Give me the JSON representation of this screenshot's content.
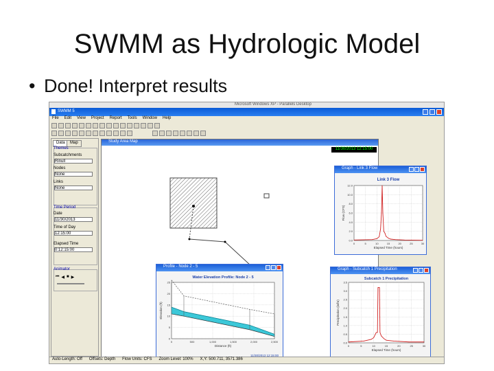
{
  "slide": {
    "title": "SWMM as Hydrologic Model",
    "bullet": "Done!  Interpret results"
  },
  "screenshot": {
    "top_title": "Microsoft Windows XP - Parallels Desktop",
    "app_title": "SWMM 5",
    "menu": [
      "File",
      "Edit",
      "View",
      "Project",
      "Report",
      "Tools",
      "Window",
      "Help"
    ],
    "left_tabs": [
      "Data",
      "Map"
    ],
    "themes_header": "Themes",
    "subcatchments_label": "Subcatchments",
    "subcatchments_value": "Rinull",
    "nodes_label": "Nodes",
    "nodes_value": "None",
    "links_label": "Links",
    "links_value": "None",
    "time_period_header": "Time Period",
    "date_label": "Date",
    "date_value": "11/30/2013",
    "time_of_day_label": "Time of Day",
    "time_of_day_value": "12:15:00",
    "elapsed_label": "Elapsed Time",
    "elapsed_value": "0:12:15:00",
    "animator_header": "Animator",
    "map_title": "Study Area Map",
    "map_time": "11/30/2013 12:15:00",
    "status": [
      "Auto-Length: Off",
      "Offsets: Depth",
      "Flow Units: CFS",
      "Zoom Level: 100%",
      "X,Y: 500.711, 3571.386"
    ]
  },
  "graphs": {
    "link": {
      "window_title": "Graph - Link 3 Flow",
      "chart_title": "Link 3 Flow",
      "ylabel": "Flow (CFS)",
      "xlabel": "Elapsed Time (hours)",
      "xticks": [
        "0",
        "5",
        "10",
        "15",
        "20",
        "25",
        "30"
      ],
      "yticks": [
        "0.0",
        "2.0",
        "4.0",
        "6.0",
        "8.0",
        "10.0",
        "12.0"
      ]
    },
    "precip": {
      "window_title": "Graph - Subcatch 1 Precipitation",
      "chart_title": "Subcatch 1 Precipitation",
      "ylabel": "Precipitation (in/hr)",
      "xlabel": "Elapsed Time (hours)",
      "xticks": [
        "0",
        "5",
        "10",
        "15",
        "20",
        "25",
        "30"
      ],
      "yticks": [
        "0.0",
        "0.5",
        "1.0",
        "1.5",
        "2.0",
        "2.5",
        "3.0",
        "3.5"
      ]
    },
    "profile": {
      "window_title": "Profile - Node 2 - 5",
      "chart_title": "Water Elevation Profile:  Node 2 - 5",
      "ylabel": "Elevation (ft)",
      "xlabel": "Distance (ft)",
      "xticks": [
        "0",
        "500",
        "1,000",
        "1,500",
        "2,000",
        "2,500"
      ],
      "yticks": [
        "0",
        "5",
        "10",
        "15",
        "20",
        "25"
      ],
      "timestamp": "11/30/2013 12:15:00"
    }
  },
  "colors": {
    "series": "#d02020",
    "water": "#3cc8d8",
    "titlebar": "#1b5fd8"
  },
  "chart_data": [
    {
      "type": "line",
      "title": "Link 3 Flow",
      "xlabel": "Elapsed Time (hours)",
      "ylabel": "Flow (CFS)",
      "xlim": [
        0,
        30
      ],
      "ylim": [
        0,
        12
      ],
      "grid": true,
      "x": [
        0,
        8,
        10,
        11,
        11.6,
        12,
        12.3,
        12.6,
        13,
        13.5,
        14,
        15,
        16,
        18,
        22,
        30
      ],
      "series": [
        {
          "values": [
            0.1,
            0.2,
            0.4,
            0.8,
            2.5,
            6,
            12,
            6,
            2,
            1.6,
            0.9,
            0.5,
            0.3,
            0.2,
            0.1,
            0.05
          ]
        }
      ]
    },
    {
      "type": "line",
      "title": "Subcatch 1 Precipitation",
      "xlabel": "Elapsed Time (hours)",
      "ylabel": "Precipitation (in/hr)",
      "xlim": [
        0,
        30
      ],
      "ylim": [
        0,
        3.5
      ],
      "grid": true,
      "x": [
        0,
        6,
        9,
        10,
        11,
        11.5,
        11.7,
        12,
        12.3,
        12.5,
        13,
        14,
        15,
        18,
        24,
        30
      ],
      "series": [
        {
          "values": [
            0.05,
            0.1,
            0.2,
            0.3,
            0.6,
            0.6,
            3.2,
            3.2,
            3.2,
            0.6,
            0.4,
            0.25,
            0.15,
            0.1,
            0.05,
            0.05
          ]
        }
      ]
    },
    {
      "type": "line",
      "title": "Water Elevation Profile:  Node 2 - 5",
      "xlabel": "Distance (ft)",
      "ylabel": "Elevation (ft)",
      "xlim": [
        0,
        2500
      ],
      "ylim": [
        0,
        25
      ],
      "grid": true,
      "x": [
        0,
        300,
        1900,
        2500
      ],
      "series": [
        {
          "values": [
            26,
            19,
            13,
            11
          ]
        },
        {
          "values": [
            11,
            10,
            4,
            1
          ]
        },
        {
          "values": [
            14,
            12,
            6,
            2
          ]
        }
      ]
    }
  ]
}
